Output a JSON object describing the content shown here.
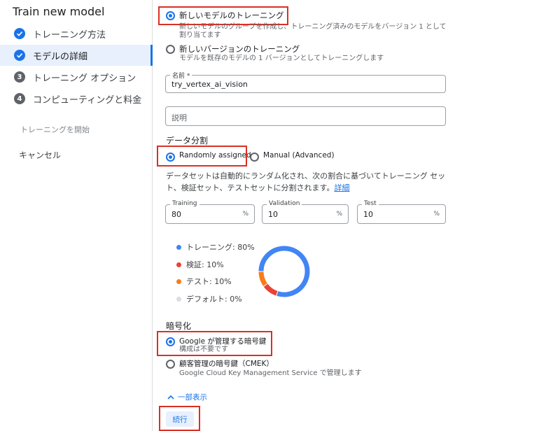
{
  "sidebar": {
    "title": "Train new model",
    "steps": [
      {
        "label": "トレーニング方法",
        "status": "done"
      },
      {
        "label": "モデルの詳細",
        "status": "done"
      },
      {
        "label": "トレーニング オプション",
        "number": "3"
      },
      {
        "label": "コンピューティングと料金",
        "number": "4"
      }
    ],
    "start_training": "トレーニングを開始",
    "cancel": "キャンセル"
  },
  "model_type": {
    "new_model": {
      "label": "新しいモデルのトレーニング",
      "description": "新しいモデルのグループを作成し、トレーニング済みのモデルをバージョン 1 として割り当てます",
      "selected": true
    },
    "new_version": {
      "label": "新しいバージョンのトレーニング",
      "description": "モデルを既存のモデルの 1 バージョンとしてトレーニングします",
      "selected": false
    }
  },
  "name_field": {
    "label": "名前 *",
    "value": "try_vertex_ai_vision"
  },
  "description_field": {
    "placeholder": "説明"
  },
  "data_split": {
    "heading": "データ分割",
    "randomly_assigned": {
      "label": "Randomly assigned",
      "selected": true
    },
    "manual": {
      "label": "Manual (Advanced)",
      "selected": false
    },
    "description": "データセットは自動的にランダム化され、次の割合に基づいてトレーニング セット、検証セット、テストセットに分割されます。",
    "details_link": "詳細",
    "training": {
      "label": "Training",
      "value": "80",
      "suffix": "%"
    },
    "validation": {
      "label": "Validation",
      "value": "10",
      "suffix": "%"
    },
    "test": {
      "label": "Test",
      "value": "10",
      "suffix": "%"
    }
  },
  "chart_data": {
    "type": "pie",
    "categories": [
      "トレーニング",
      "検証",
      "テスト",
      "デフォルト"
    ],
    "values": [
      80,
      10,
      10,
      0
    ],
    "legend_labels": [
      "トレーニング: 80%",
      "検証: 10%",
      "テスト: 10%",
      "デフォルト: 0%"
    ],
    "colors": [
      "#4285f4",
      "#ea4335",
      "#fa7b17",
      "#dadce0"
    ]
  },
  "encryption": {
    "heading": "暗号化",
    "google_managed": {
      "label": "Google が管理する暗号鍵",
      "description": "構成は不要です",
      "selected": true
    },
    "cmek": {
      "label": "顧客管理の暗号鍵（CMEK）",
      "description": "Google Cloud Key Management Service で管理します",
      "selected": false
    }
  },
  "show_less": "一部表示",
  "continue_button": "続行",
  "colors": {
    "accent": "#1a73e8",
    "highlight": "#d93025"
  }
}
